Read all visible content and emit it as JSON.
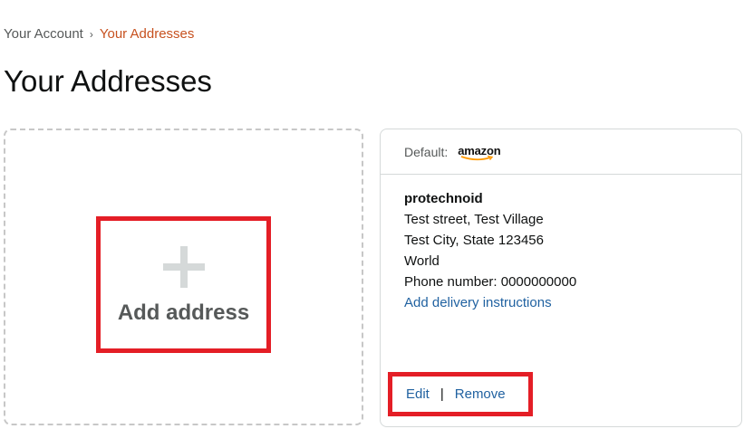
{
  "breadcrumb": {
    "account": "Your Account",
    "separator": "›",
    "current": "Your Addresses"
  },
  "page": {
    "title": "Your Addresses"
  },
  "add_tile": {
    "label": "Add address"
  },
  "address_card": {
    "default_label": "Default:",
    "brand": "amazon",
    "name": "protechnoid",
    "line1": "Test street, Test Village",
    "line2": "Test City, State 123456",
    "country": "World",
    "phone": "Phone number: 0000000000",
    "instructions_link": "Add delivery instructions",
    "edit_label": "Edit",
    "divider": "|",
    "remove_label": "Remove"
  },
  "colors": {
    "link": "#2162A1",
    "breadcrumb_current": "#C7511F",
    "highlight": "#E41E26",
    "brand_smile": "#FF9900"
  }
}
